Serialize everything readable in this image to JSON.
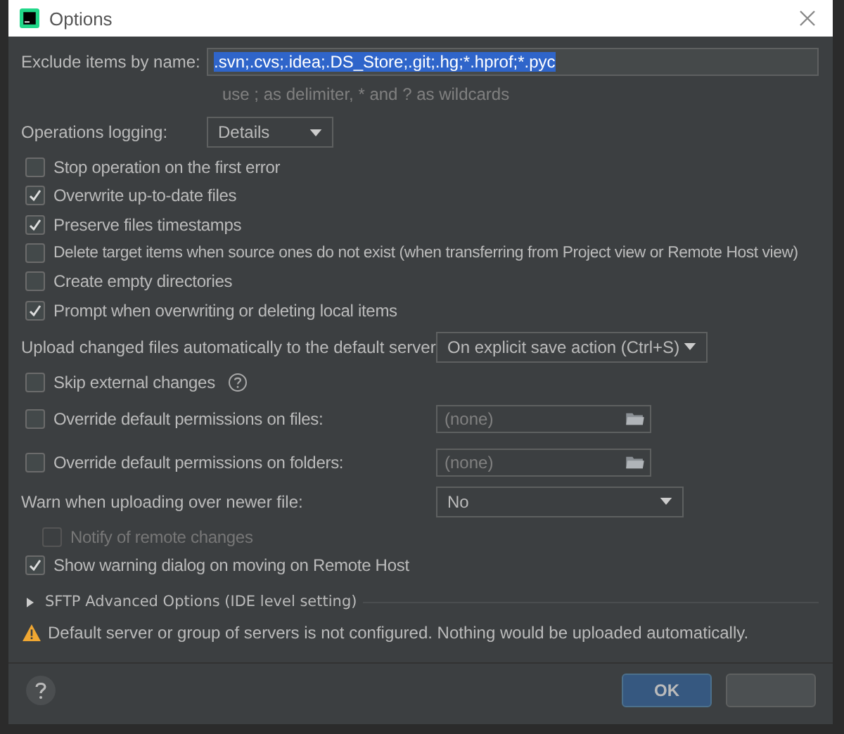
{
  "window": {
    "title": "Options"
  },
  "exclude": {
    "label": "Exclude items by name:",
    "value": ".svn;.cvs;.idea;.DS_Store;.git;.hg;*.hprof;*.pyc",
    "hint": "use ; as delimiter, * and ? as wildcards"
  },
  "logging": {
    "label": "Operations logging:",
    "value": "Details"
  },
  "options": [
    {
      "label": "Stop operation on the first error",
      "checked": false
    },
    {
      "label": "Overwrite up-to-date files",
      "checked": true
    },
    {
      "label": "Preserve files timestamps",
      "checked": true
    },
    {
      "label": "Delete target items when source ones do not exist (when transferring from Project view or Remote Host view)",
      "checked": false
    },
    {
      "label": "Create empty directories",
      "checked": false
    },
    {
      "label": "Prompt when overwriting or deleting local items",
      "checked": true
    }
  ],
  "upload": {
    "label": "Upload changed files automatically to the default server",
    "value": "On explicit save action (Ctrl+S)"
  },
  "settings": [
    {
      "kind": "help",
      "label": "Skip external changes",
      "checked": false
    },
    {
      "kind": "field",
      "label": "Override default permissions on files:",
      "checked": false,
      "placeholder": "(none)"
    },
    {
      "kind": "field",
      "label": "Override default permissions on folders:",
      "checked": false,
      "placeholder": "(none)"
    }
  ],
  "warn": {
    "label": "Warn when uploading over newer file:",
    "value": "No"
  },
  "notify": {
    "label": "Notify of remote changes",
    "checked": false,
    "disabled": true
  },
  "show_warning": {
    "label": "Show warning dialog on moving on Remote Host",
    "checked": true,
    "disabled": false
  },
  "advanced": {
    "label": "SFTP Advanced Options (IDE level setting)",
    "expanded": false
  },
  "warning": "Default server or group of servers is not configured. Nothing would be uploaded automatically.",
  "buttons": [
    {
      "label": "OK",
      "primary": true
    },
    {
      "primary": false
    }
  ]
}
